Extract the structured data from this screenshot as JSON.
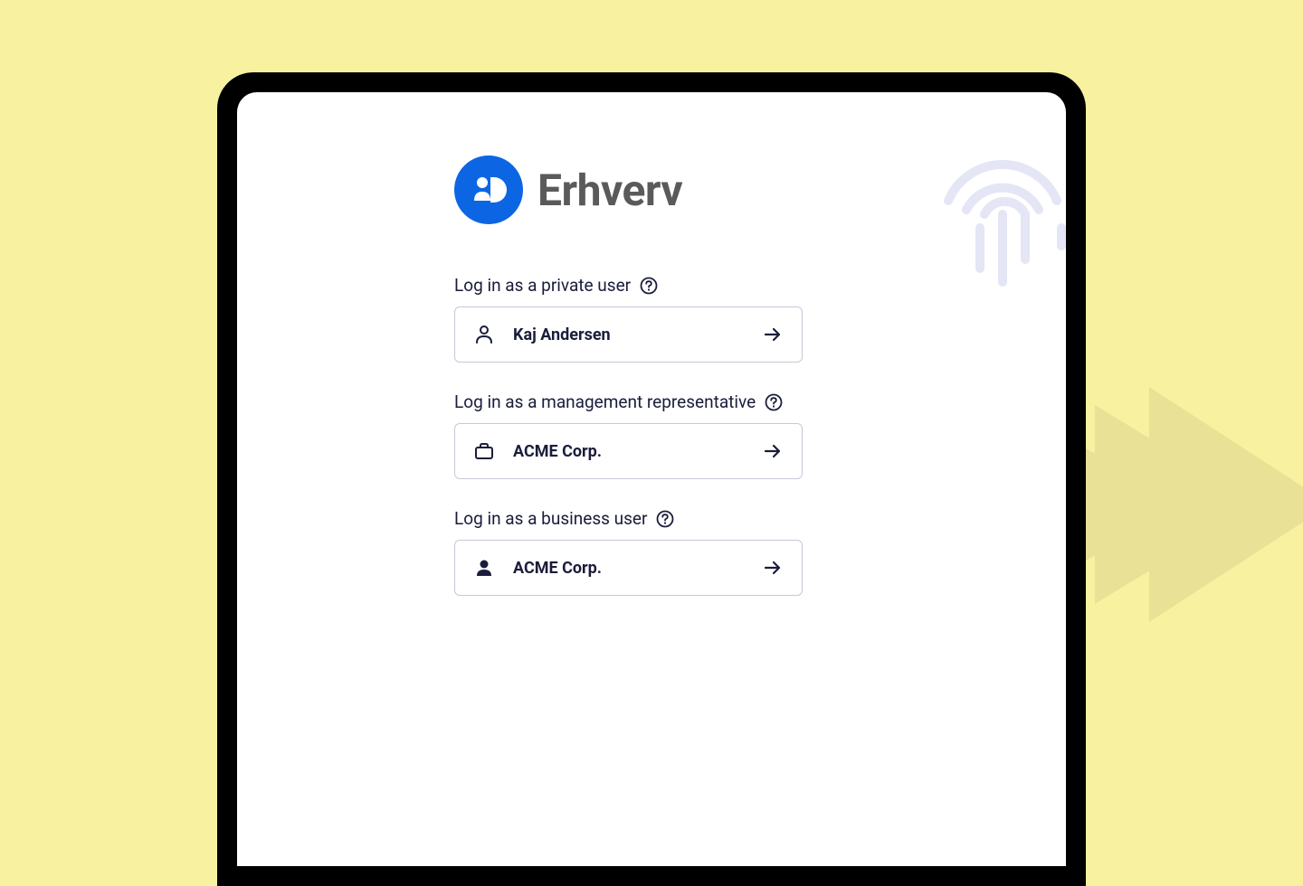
{
  "brand": {
    "title": "Erhverv"
  },
  "sections": {
    "private": {
      "label": "Log in as a private user",
      "option": "Kaj Andersen"
    },
    "management": {
      "label": "Log in as a management representative",
      "option": "ACME Corp."
    },
    "business": {
      "label": "Log in as a business user",
      "option": "ACME Corp."
    }
  }
}
